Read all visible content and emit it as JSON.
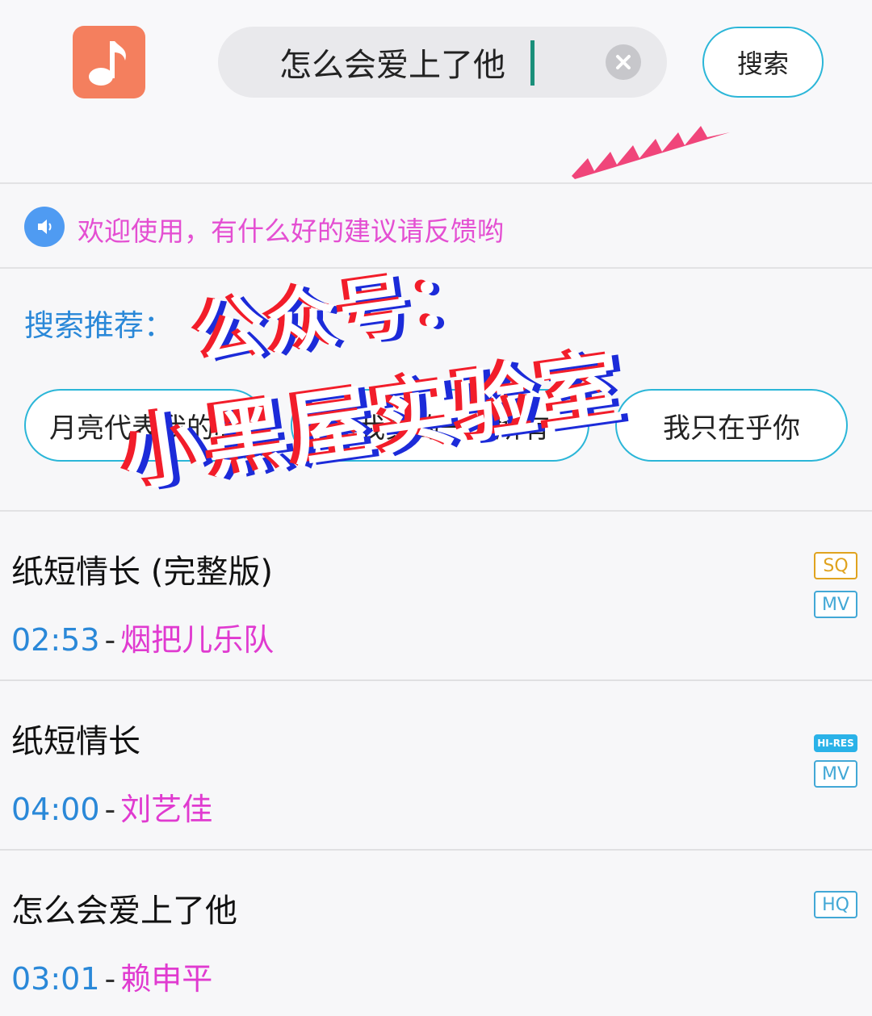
{
  "search": {
    "query": "怎么会爱上了他",
    "button_label": "搜索"
  },
  "notice": {
    "text": "欢迎使用，有什么好的建议请反馈哟"
  },
  "recommend": {
    "title": "搜索推荐：",
    "chips": [
      "月亮代表我的心",
      "是我真的一无所有",
      "我只在乎你"
    ]
  },
  "songs": [
    {
      "title": "纸短情长 (完整版)",
      "duration": "02:53",
      "separator": "-",
      "artist": "烟把儿乐队",
      "badges": [
        "SQ",
        "MV"
      ]
    },
    {
      "title": "纸短情长",
      "duration": "04:00",
      "separator": "-",
      "artist": "刘艺佳",
      "badges": [
        "HI-RES",
        "MV"
      ]
    },
    {
      "title": "怎么会爱上了他",
      "duration": "03:01",
      "separator": "-",
      "artist": "赖申平",
      "badges": [
        "HQ"
      ]
    }
  ],
  "watermark": {
    "line1": "公众号：",
    "line2": "小黑屋实验室"
  },
  "colors": {
    "accent": "#2bb6d8",
    "app_icon": "#f47f5e",
    "notice_text": "#e44fd2",
    "duration": "#2a88d8",
    "artist": "#e03ad0",
    "sq_badge": "#e0a31f"
  },
  "icons": {
    "app": "music-note-icon",
    "clear": "clear-icon",
    "notice": "speaker-icon"
  }
}
